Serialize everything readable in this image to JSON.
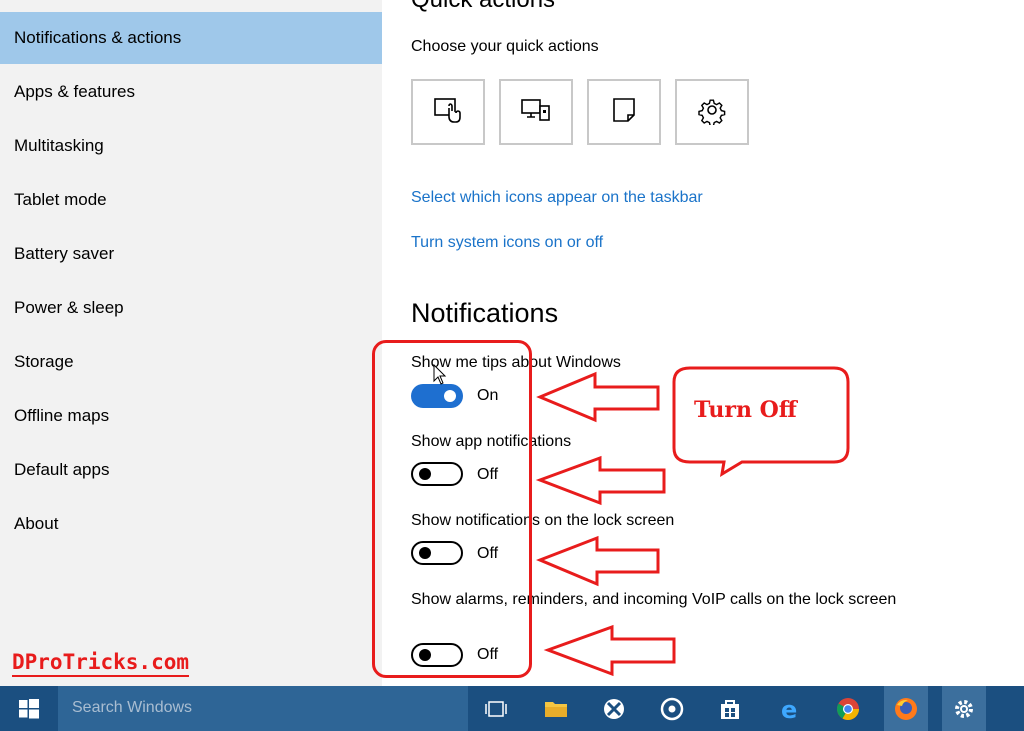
{
  "sidebar": {
    "items": [
      {
        "label": "Notifications & actions",
        "selected": true
      },
      {
        "label": "Apps & features"
      },
      {
        "label": "Multitasking"
      },
      {
        "label": "Tablet mode"
      },
      {
        "label": "Battery saver"
      },
      {
        "label": "Power & sleep"
      },
      {
        "label": "Storage"
      },
      {
        "label": "Offline maps"
      },
      {
        "label": "Default apps"
      },
      {
        "label": "About"
      }
    ]
  },
  "main": {
    "quick_actions_title": "Quick actions",
    "quick_actions_subtitle": "Choose your quick actions",
    "quick_action_icons": [
      "tablet-mode-icon",
      "project-icon",
      "note-icon",
      "settings-icon"
    ],
    "links": {
      "taskbar_icons": "Select which icons appear on the taskbar",
      "system_icons": "Turn system icons on or off"
    },
    "notifications_title": "Notifications",
    "settings": [
      {
        "label": "Show me tips about Windows",
        "state": "On"
      },
      {
        "label": "Show app notifications",
        "state": "Off"
      },
      {
        "label": "Show notifications on the lock screen",
        "state": "Off"
      },
      {
        "label": "Show alarms, reminders, and incoming VoIP calls on the lock screen",
        "state": "Off"
      }
    ]
  },
  "annotations": {
    "callout": "Turn Off",
    "watermark": "DProTricks.com"
  },
  "taskbar": {
    "search_placeholder": "Search Windows",
    "icons": [
      "task-view-icon",
      "file-explorer-icon",
      "xbox-icon",
      "groove-music-icon",
      "store-icon",
      "edge-icon",
      "chrome-icon",
      "firefox-icon",
      "settings-icon"
    ]
  },
  "colors": {
    "accent": "#1e6fd0",
    "selected_nav": "#9fc8ea",
    "link": "#1a73c9",
    "annotation_red": "#e81c1c",
    "taskbar": "#1b4f80"
  }
}
